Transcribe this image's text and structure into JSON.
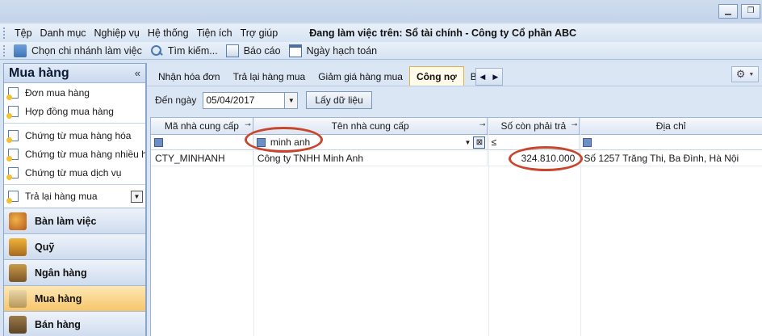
{
  "menu": {
    "items": [
      "Tệp",
      "Danh mục",
      "Nghiệp vụ",
      "Hệ thống",
      "Tiện ích",
      "Trợ giúp"
    ],
    "status": "Đang làm việc trên: Sổ tài chính - Công ty Cổ phần ABC"
  },
  "toolbar": {
    "branch_label": "Chọn chi nhánh làm việc",
    "search_label": "Tìm kiếm...",
    "report_label": "Báo cáo",
    "accounting_date_label": "Ngày hạch toán"
  },
  "sidebar": {
    "title": "Mua hàng",
    "items": [
      "Đơn mua hàng",
      "Hợp đồng mua hàng"
    ],
    "items2": [
      "Chứng từ mua hàng hóa",
      "Chứng từ mua hàng nhiều h...",
      "Chứng từ mua dịch vụ"
    ],
    "combo_value": "Trả lại hàng mua",
    "modules": [
      "Bàn làm việc",
      "Quỹ",
      "Ngân hàng",
      "Mua hàng",
      "Bán hàng"
    ]
  },
  "tabs": [
    "Nhận hóa đơn",
    "Trả lại hàng mua",
    "Giảm giá hàng mua",
    "Công nợ",
    "B"
  ],
  "active_tab": "Công nợ",
  "filter": {
    "date_label": "Đến ngày",
    "date_value": "05/04/2017",
    "load_button": "Lấy dữ liệu"
  },
  "grid": {
    "columns": [
      "Mã nhà cung cấp",
      "Tên nhà cung cấp",
      "Số còn phải trả",
      "Địa chỉ"
    ],
    "filter_values": {
      "name": "minh anh",
      "amount_operator": "≤"
    },
    "rows": [
      {
        "code": "CTY_MINHANH",
        "name": "Công ty TNHH Minh Anh",
        "amount": "324.810.000",
        "address": "Số 1257 Trăng Thi, Ba Đình, Hà Nội"
      }
    ]
  },
  "accent_colors": {
    "active_module": "#f7c66b",
    "annotation": "#c8462c"
  }
}
